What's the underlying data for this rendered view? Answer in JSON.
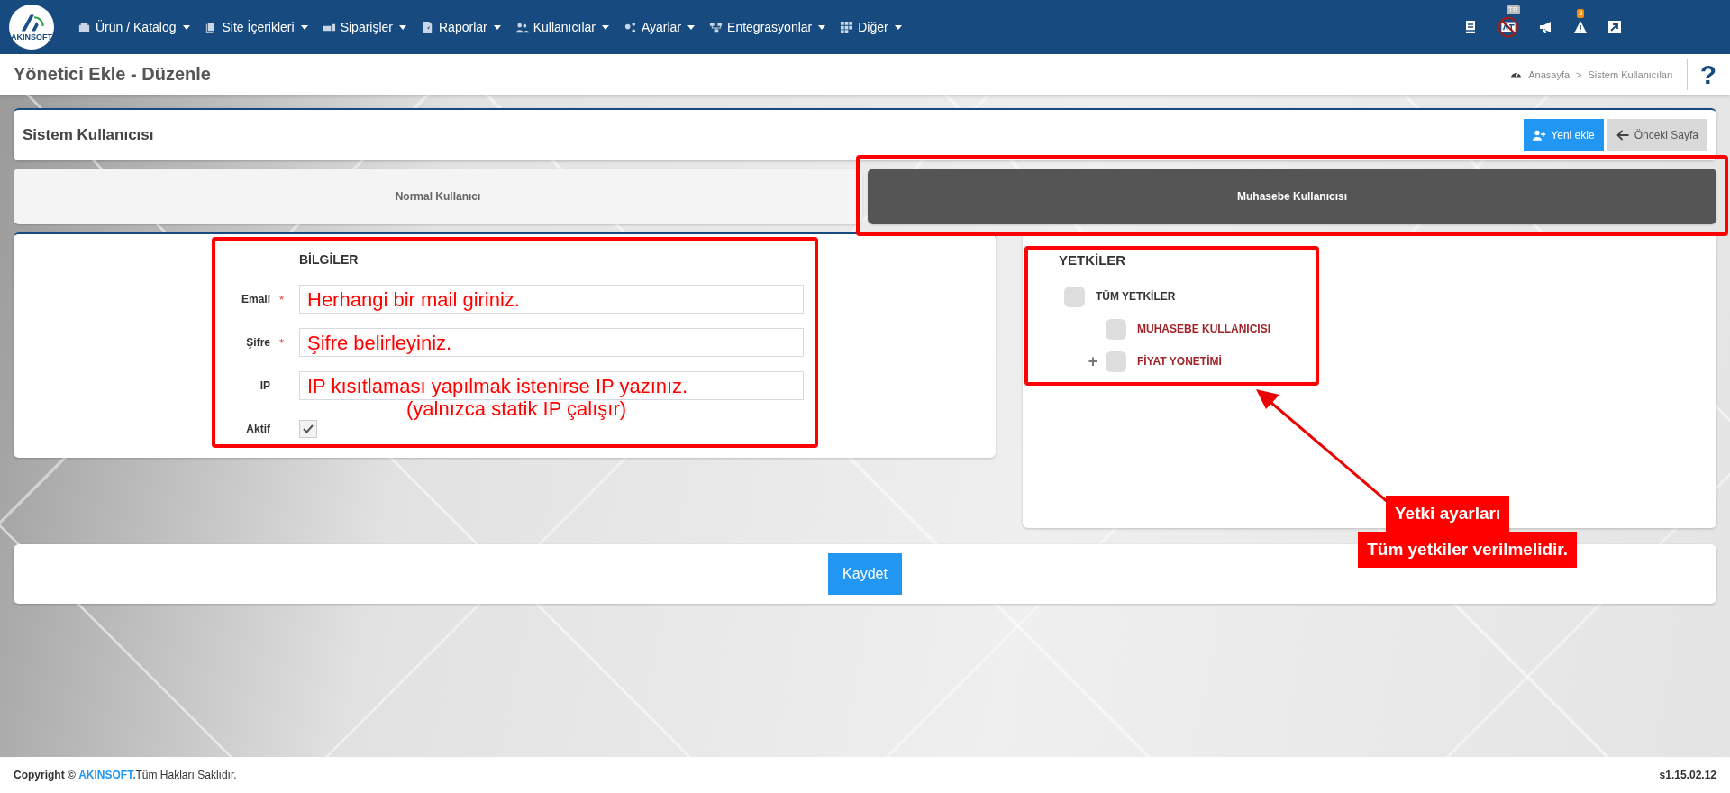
{
  "navbar": {
    "logo_text": "AKINSOFT",
    "menu": [
      {
        "label": "Ürün / Katalog"
      },
      {
        "label": "Site İçerikleri"
      },
      {
        "label": "Siparişler"
      },
      {
        "label": "Raporlar"
      },
      {
        "label": "Kullanıcılar"
      },
      {
        "label": "Ayarlar"
      },
      {
        "label": "Entegrasyonlar"
      },
      {
        "label": "Diğer"
      }
    ],
    "tools": [
      {
        "kind": "book"
      },
      {
        "kind": "translate",
        "badge": "TR",
        "disabled": true
      },
      {
        "kind": "megaphone"
      },
      {
        "kind": "warning",
        "badge": "3"
      },
      {
        "kind": "external"
      }
    ]
  },
  "page_title": "Yönetici Ekle - Düzenle",
  "breadcrumb": [
    {
      "label": "Anasayfa"
    },
    {
      "label": ">"
    },
    {
      "label": "Sistem Kullanıcıları"
    }
  ],
  "help": "?",
  "card": {
    "title": "Sistem Kullanıcısı",
    "buttons": [
      {
        "label": "Yeni ekle",
        "kind": "primary"
      },
      {
        "label": "Önceki Sayfa",
        "kind": "back"
      }
    ]
  },
  "tabs": [
    {
      "label": "Normal Kullanıcı",
      "selected": false
    },
    {
      "label": "Muhasebe Kullanıcısı",
      "selected": true
    }
  ],
  "form": {
    "heading": "BİLGİLER",
    "fields": [
      {
        "label": "Email",
        "required": "*",
        "kind": "text",
        "annotation": "Herhangi bir mail giriniz."
      },
      {
        "label": "Şifre",
        "required": "*",
        "kind": "text",
        "annotation": "Şifre belirleyiniz."
      },
      {
        "label": "IP",
        "kind": "text",
        "annotation": "IP kısıtlaması yapılmak istenirse IP yazınız.",
        "annotation_2": "(yalnızca statik IP çalışır)"
      },
      {
        "label": "Aktif",
        "kind": "checkbox",
        "checked": true
      }
    ]
  },
  "permissions": {
    "heading": "YETKİLER",
    "tree": [
      {
        "label": "TÜM YETKİLER",
        "checked": false,
        "children": [
          {
            "label": "MUHASEBE KULLANICISI",
            "checked": false
          },
          {
            "label": "FİYAT YONETİMİ",
            "checked": false,
            "expander": "+"
          }
        ]
      }
    ]
  },
  "save_button": "Kaydet",
  "callout": [
    "Yetki ayarları",
    "Tüm yetkiler verilmelidir."
  ],
  "footer": {
    "copyright": "Copyright ©",
    "brand": "AKINSOFT.",
    "rights": "Tüm Hakları Saklıdır.",
    "version": "s1.15.02.12"
  }
}
